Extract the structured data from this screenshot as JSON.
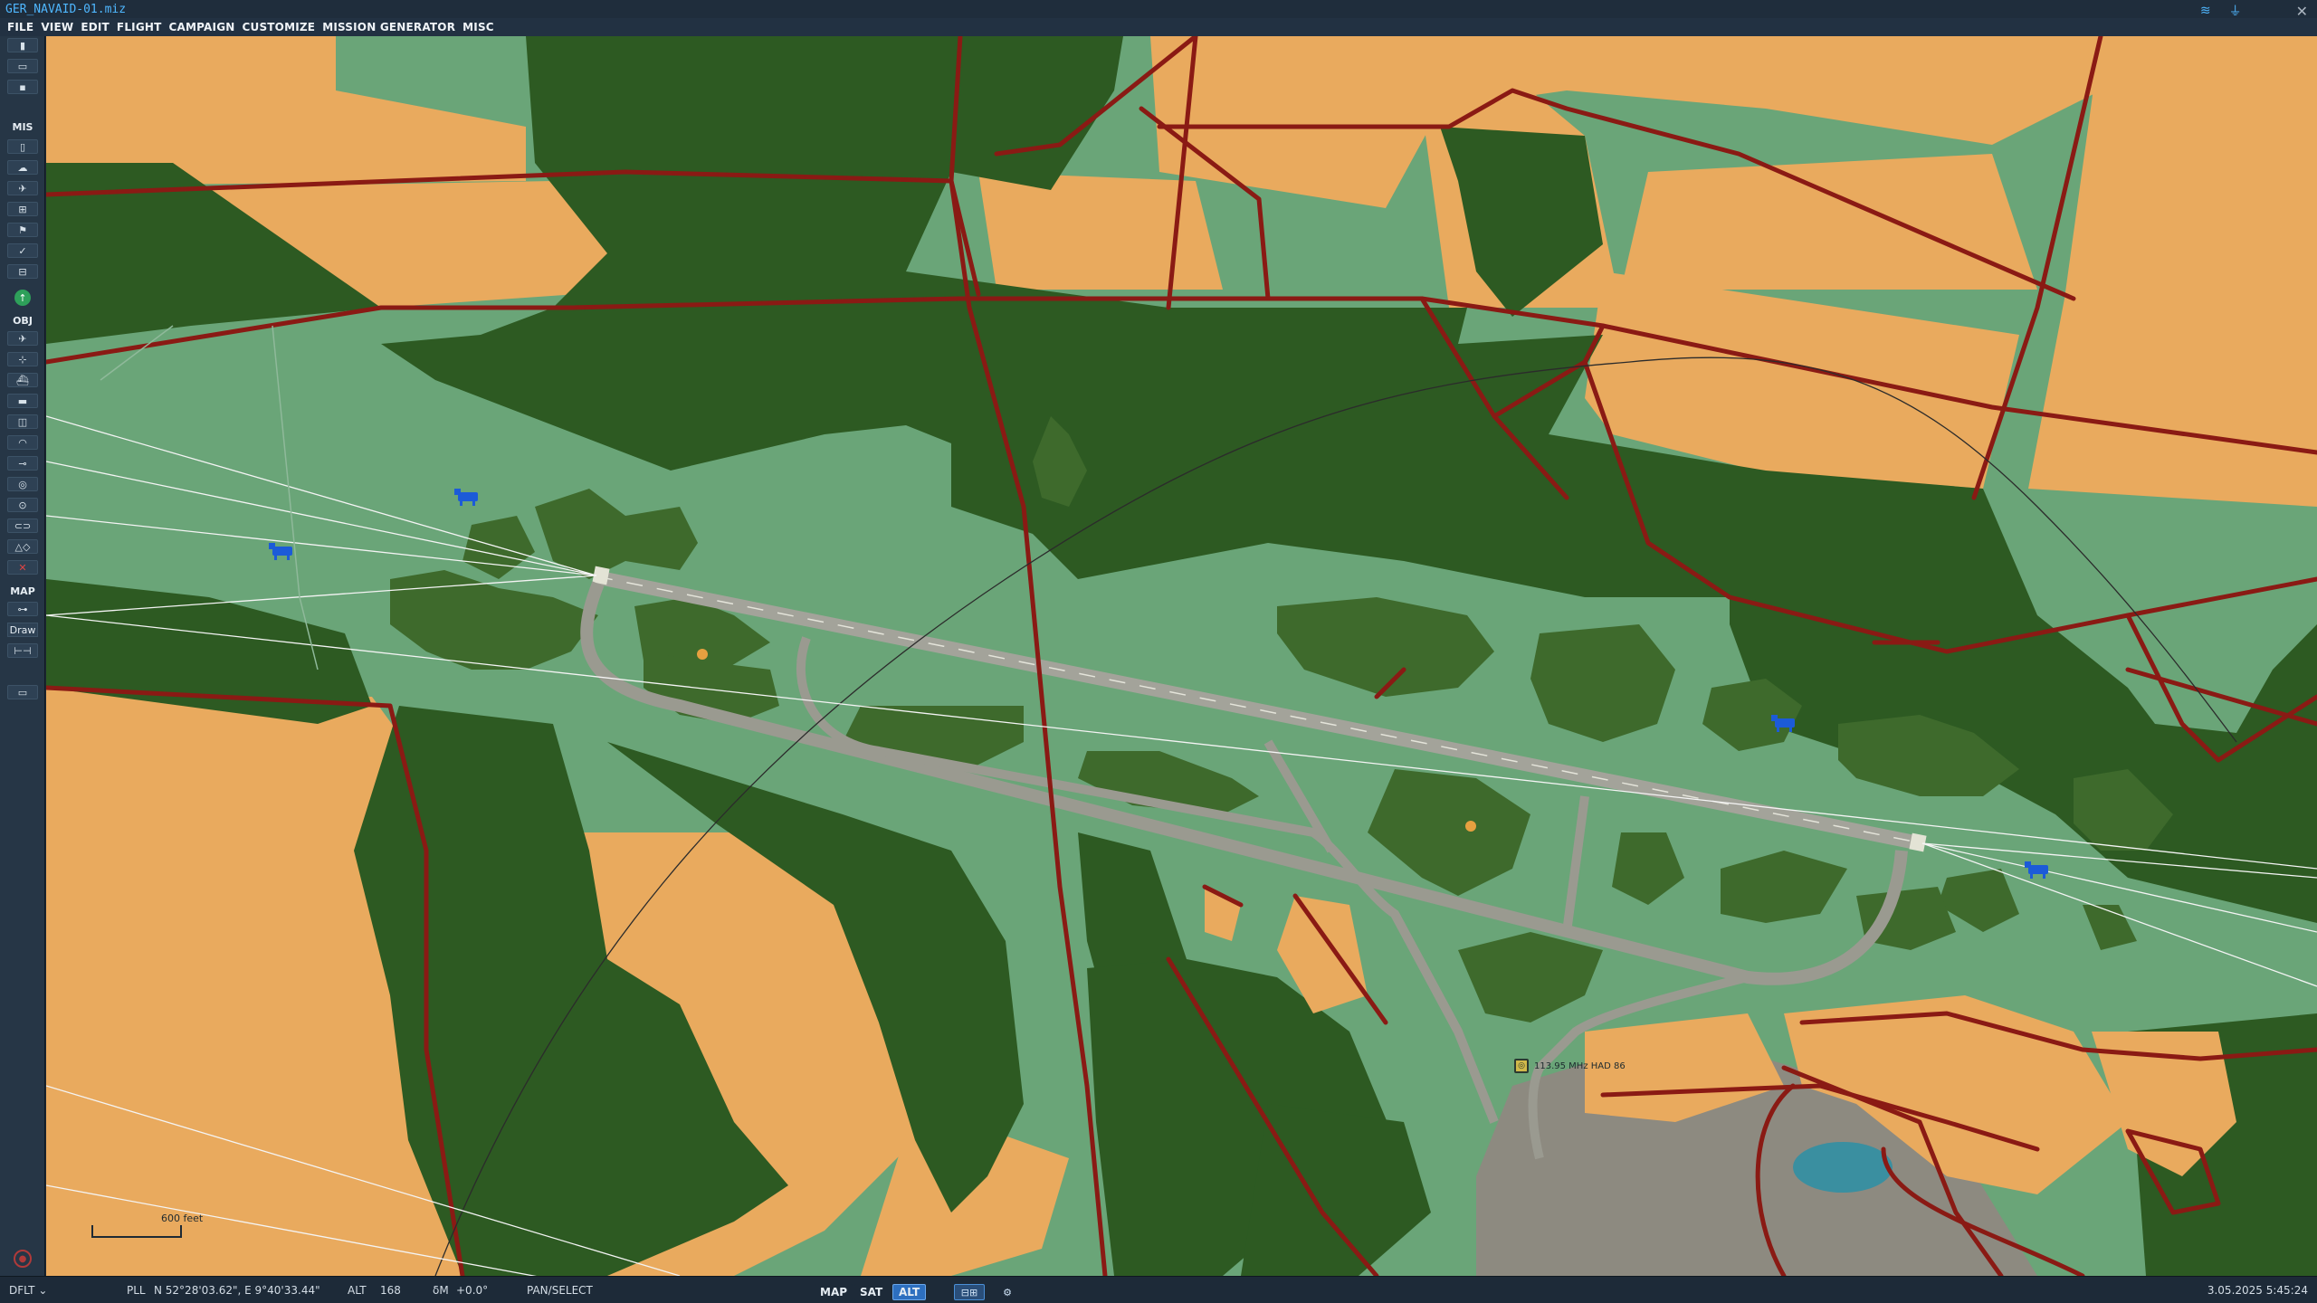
{
  "window": {
    "title": "GER_NAVAID-01.miz",
    "wifi_icon": "wifi-icon",
    "antenna_icon": "antenna-icon",
    "close_icon": "close-icon"
  },
  "menu": [
    "FILE",
    "VIEW",
    "EDIT",
    "FLIGHT",
    "CAMPAIGN",
    "CUSTOMIZE",
    "MISSION GENERATOR",
    "MISC"
  ],
  "toolbar": {
    "section_mis": "MIS",
    "section_obj": "OBJ",
    "section_map": "MAP",
    "draw_label": "Draw",
    "top_buttons": [
      {
        "name": "new-file-icon",
        "glyph": "▮"
      },
      {
        "name": "open-file-icon",
        "glyph": "▭"
      },
      {
        "name": "save-file-icon",
        "glyph": "▪"
      }
    ],
    "mis_buttons": [
      {
        "name": "mission-briefing-icon",
        "glyph": "▯"
      },
      {
        "name": "weather-icon",
        "glyph": "☁"
      },
      {
        "name": "failures-icon",
        "glyph": "✈"
      },
      {
        "name": "triggers-icon",
        "glyph": "⊞"
      },
      {
        "name": "mission-goals-icon",
        "glyph": "⚑"
      },
      {
        "name": "check-icon",
        "glyph": "✓"
      },
      {
        "name": "resource-manager-icon",
        "glyph": "⊟"
      }
    ],
    "obj_buttons": [
      {
        "name": "plane-group-icon",
        "glyph": "✈"
      },
      {
        "name": "helicopter-group-icon",
        "glyph": "⊹"
      },
      {
        "name": "ship-group-icon",
        "glyph": "⛴"
      },
      {
        "name": "vehicle-group-icon",
        "glyph": "▬"
      },
      {
        "name": "static-object-icon",
        "glyph": "◫"
      },
      {
        "name": "template-icon",
        "glyph": "◠"
      },
      {
        "name": "navigation-point-icon",
        "glyph": "⊸"
      },
      {
        "name": "trigger-zone-icon",
        "glyph": "◎"
      },
      {
        "name": "ins-point-icon",
        "glyph": "⊙"
      },
      {
        "name": "group-icon",
        "glyph": "⊂⊃"
      },
      {
        "name": "shapes-icon",
        "glyph": "△◇"
      },
      {
        "name": "delete-icon",
        "glyph": "✕"
      }
    ],
    "map_buttons": [
      {
        "name": "map-key-icon",
        "glyph": "⊶"
      },
      {
        "name": "ruler-icon",
        "glyph": "⊢⊣"
      },
      {
        "name": "map-layer-icon",
        "glyph": "▭"
      }
    ],
    "bottom_icon": "stop-icon",
    "go_icon": "up-arrow-icon"
  },
  "map": {
    "scale_label": "600 feet",
    "navaid_text": "113.95 MHz HAD 86",
    "colors": {
      "grass": "#6aa578",
      "forest": "#2d5a22",
      "field": "#e9aa5e",
      "road": "#8a1a14",
      "runway": "#9c9c92",
      "urban": "#8d8a80"
    }
  },
  "status": {
    "profile": "DFLT",
    "coord_mode": "PLL",
    "coords": "N 52°28'03.62\", E 9°40'33.44\"",
    "alt_label": "ALT",
    "alt_value": "168",
    "mag_label": "δM",
    "mag_value": "+0.0°",
    "tool_mode": "PAN/SELECT",
    "view_modes": [
      "MAP",
      "SAT",
      "ALT"
    ],
    "active_view": "ALT",
    "datetime": "3.05.2025 5:45:24"
  }
}
